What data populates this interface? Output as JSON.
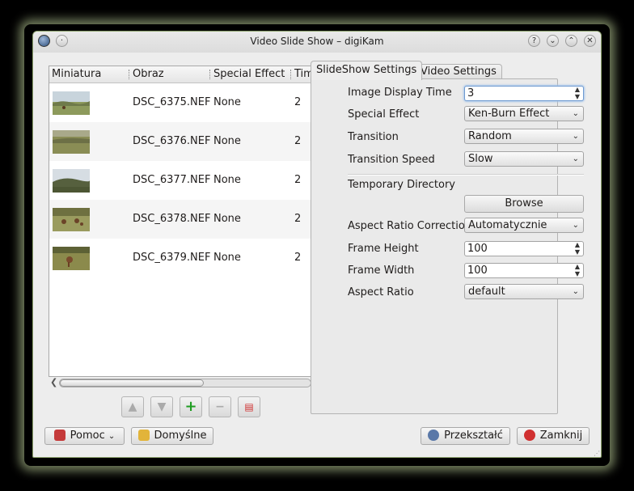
{
  "window": {
    "title": "Video Slide Show – digiKam"
  },
  "list": {
    "headers": [
      "Miniatura",
      "Obraz",
      "Special Effect",
      "Time (se"
    ],
    "rows": [
      {
        "image": "DSC_6375.NEF",
        "effect": "None",
        "time": "2"
      },
      {
        "image": "DSC_6376.NEF",
        "effect": "None",
        "time": "2"
      },
      {
        "image": "DSC_6377.NEF",
        "effect": "None",
        "time": "2"
      },
      {
        "image": "DSC_6378.NEF",
        "effect": "None",
        "time": "2"
      },
      {
        "image": "DSC_6379.NEF",
        "effect": "None",
        "time": "2"
      }
    ]
  },
  "toolbar": {
    "buttons": [
      "move-up-icon",
      "move-down-icon",
      "add-icon",
      "remove-icon",
      "clear-list-icon"
    ]
  },
  "tabs": {
    "slideshow": "SlideShow Settings",
    "video": "Video Settings"
  },
  "settings": {
    "image_display_time_label": "Image Display Time",
    "image_display_time_value": "3",
    "special_effect_label": "Special Effect",
    "special_effect_value": "Ken-Burn Effect",
    "transition_label": "Transition",
    "transition_value": "Random",
    "transition_speed_label": "Transition Speed",
    "transition_speed_value": "Slow",
    "temp_dir_label": "Temporary Directory",
    "browse_label": "Browse",
    "aspect_corr_label": "Aspect Ratio Correction",
    "aspect_corr_value": "Automatycznie",
    "frame_height_label": "Frame Height",
    "frame_height_value": "100",
    "frame_width_label": "Frame Width",
    "frame_width_value": "100",
    "aspect_ratio_label": "Aspect Ratio",
    "aspect_ratio_value": "default"
  },
  "footer": {
    "help": "Pomoc",
    "defaults": "Domyślne",
    "convert": "Przekształć",
    "close": "Zamknij"
  },
  "colors": {
    "accent": "#6f9ad0",
    "add_green": "#1f9d22",
    "close_red": "#d03030"
  }
}
